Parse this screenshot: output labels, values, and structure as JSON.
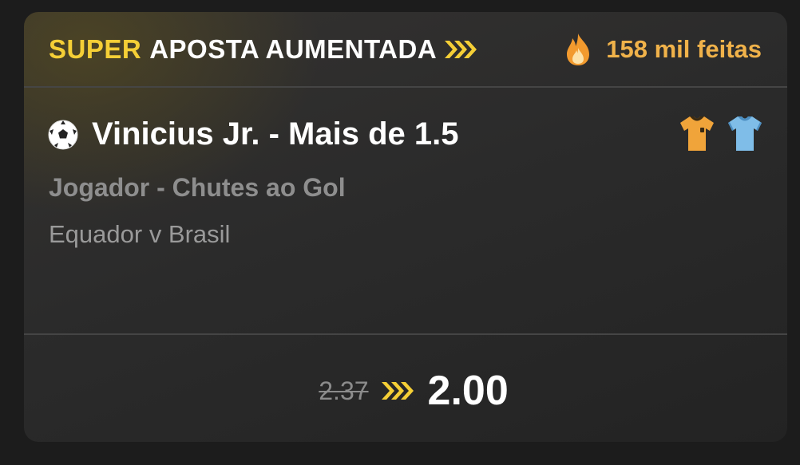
{
  "header": {
    "badge_super": "SUPER",
    "badge_label": "APOSTA AUMENTADA",
    "popularity": "158 mil feitas"
  },
  "selection": {
    "title": "Vinicius Jr. - Mais de 1.5",
    "market": "Jogador - Chutes ao Gol",
    "event": "Equador v Brasil",
    "icon": "soccer-ball-icon",
    "jerseys": [
      "home-jersey-icon",
      "away-jersey-icon"
    ]
  },
  "odds": {
    "original": "2.37",
    "boosted": "2.00"
  },
  "colors": {
    "accent_yellow": "#f5cf36",
    "popularity_orange": "#f0b24a",
    "home_jersey": "#f0a43a",
    "away_jersey": "#7fbde8"
  }
}
